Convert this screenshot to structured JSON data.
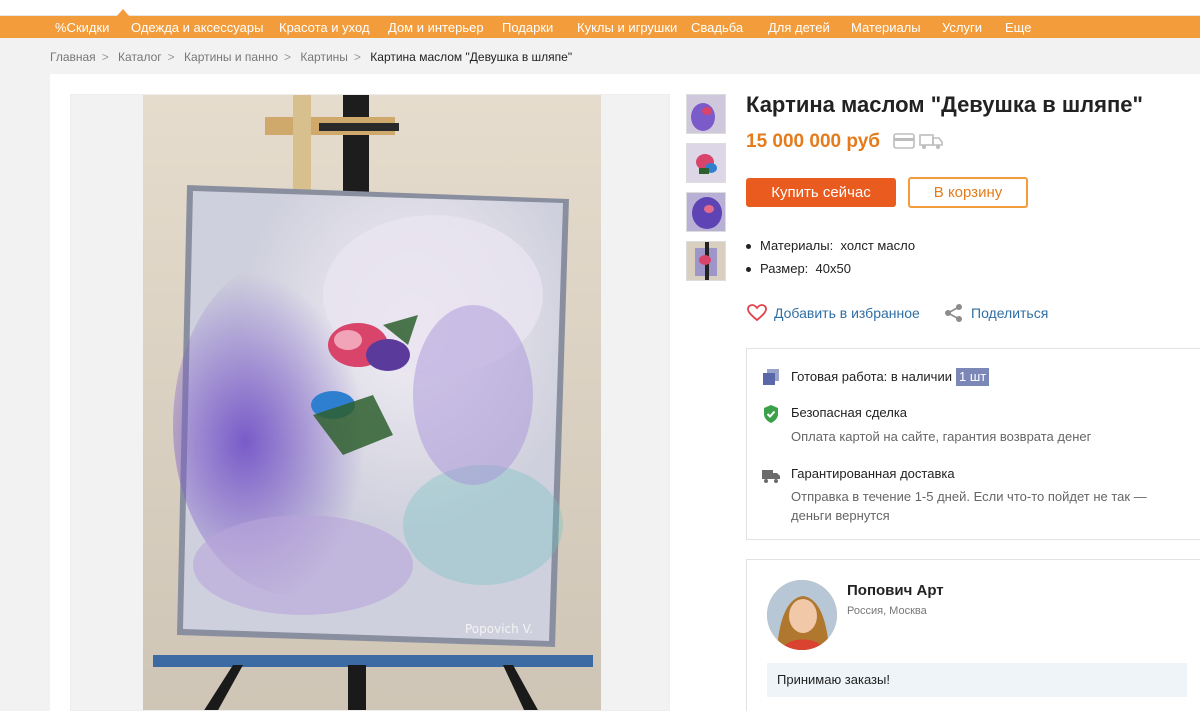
{
  "nav": {
    "items": [
      "%Скидки",
      "Одежда и аксессуары",
      "Красота и уход",
      "Дом и интерьер",
      "Подарки",
      "Куклы и игрушки",
      "Свадьба",
      "Для детей",
      "Материалы",
      "Услуги",
      "Еще"
    ]
  },
  "breadcrumb": {
    "items": [
      "Главная",
      "Каталог",
      "Картины и панно",
      "Картины"
    ],
    "current": "Картина маслом \"Девушка в шляпе\"",
    "separator": ">"
  },
  "product": {
    "title": "Картина маслом \"Девушка в шляпе\"",
    "price": "15 000 000 руб",
    "buy_label": "Купить сейчас",
    "cart_label": "В корзину",
    "attributes": [
      {
        "name": "Материалы:",
        "value": "холст масло"
      },
      {
        "name": "Размер:",
        "value": "40х50"
      }
    ],
    "favorite_label": "Добавить в избранное",
    "share_label": "Поделиться",
    "painting_signature": "Popovich V.",
    "thumbnail_count": 4
  },
  "info": {
    "ready": {
      "title": "Готовая работа: в наличии",
      "qty": "1 шт"
    },
    "safe": {
      "title": "Безопасная сделка",
      "text": "Оплата картой на сайте, гарантия возврата денег"
    },
    "delivery": {
      "title": "Гарантированная доставка",
      "text": "Отправка в течение 1-5 дней. Если что-то пойдет не так — деньги вернутся"
    }
  },
  "seller": {
    "name": "Попович Арт",
    "location": "Россия, Москва",
    "note": "Принимаю заказы!"
  },
  "colors": {
    "nav_bg": "#f39c3b",
    "buy_button": "#ea5b1f",
    "price": "#e47c1c",
    "link": "#2f6ea5",
    "qty_badge": "#7b88b7",
    "shield": "#3aa14a"
  }
}
